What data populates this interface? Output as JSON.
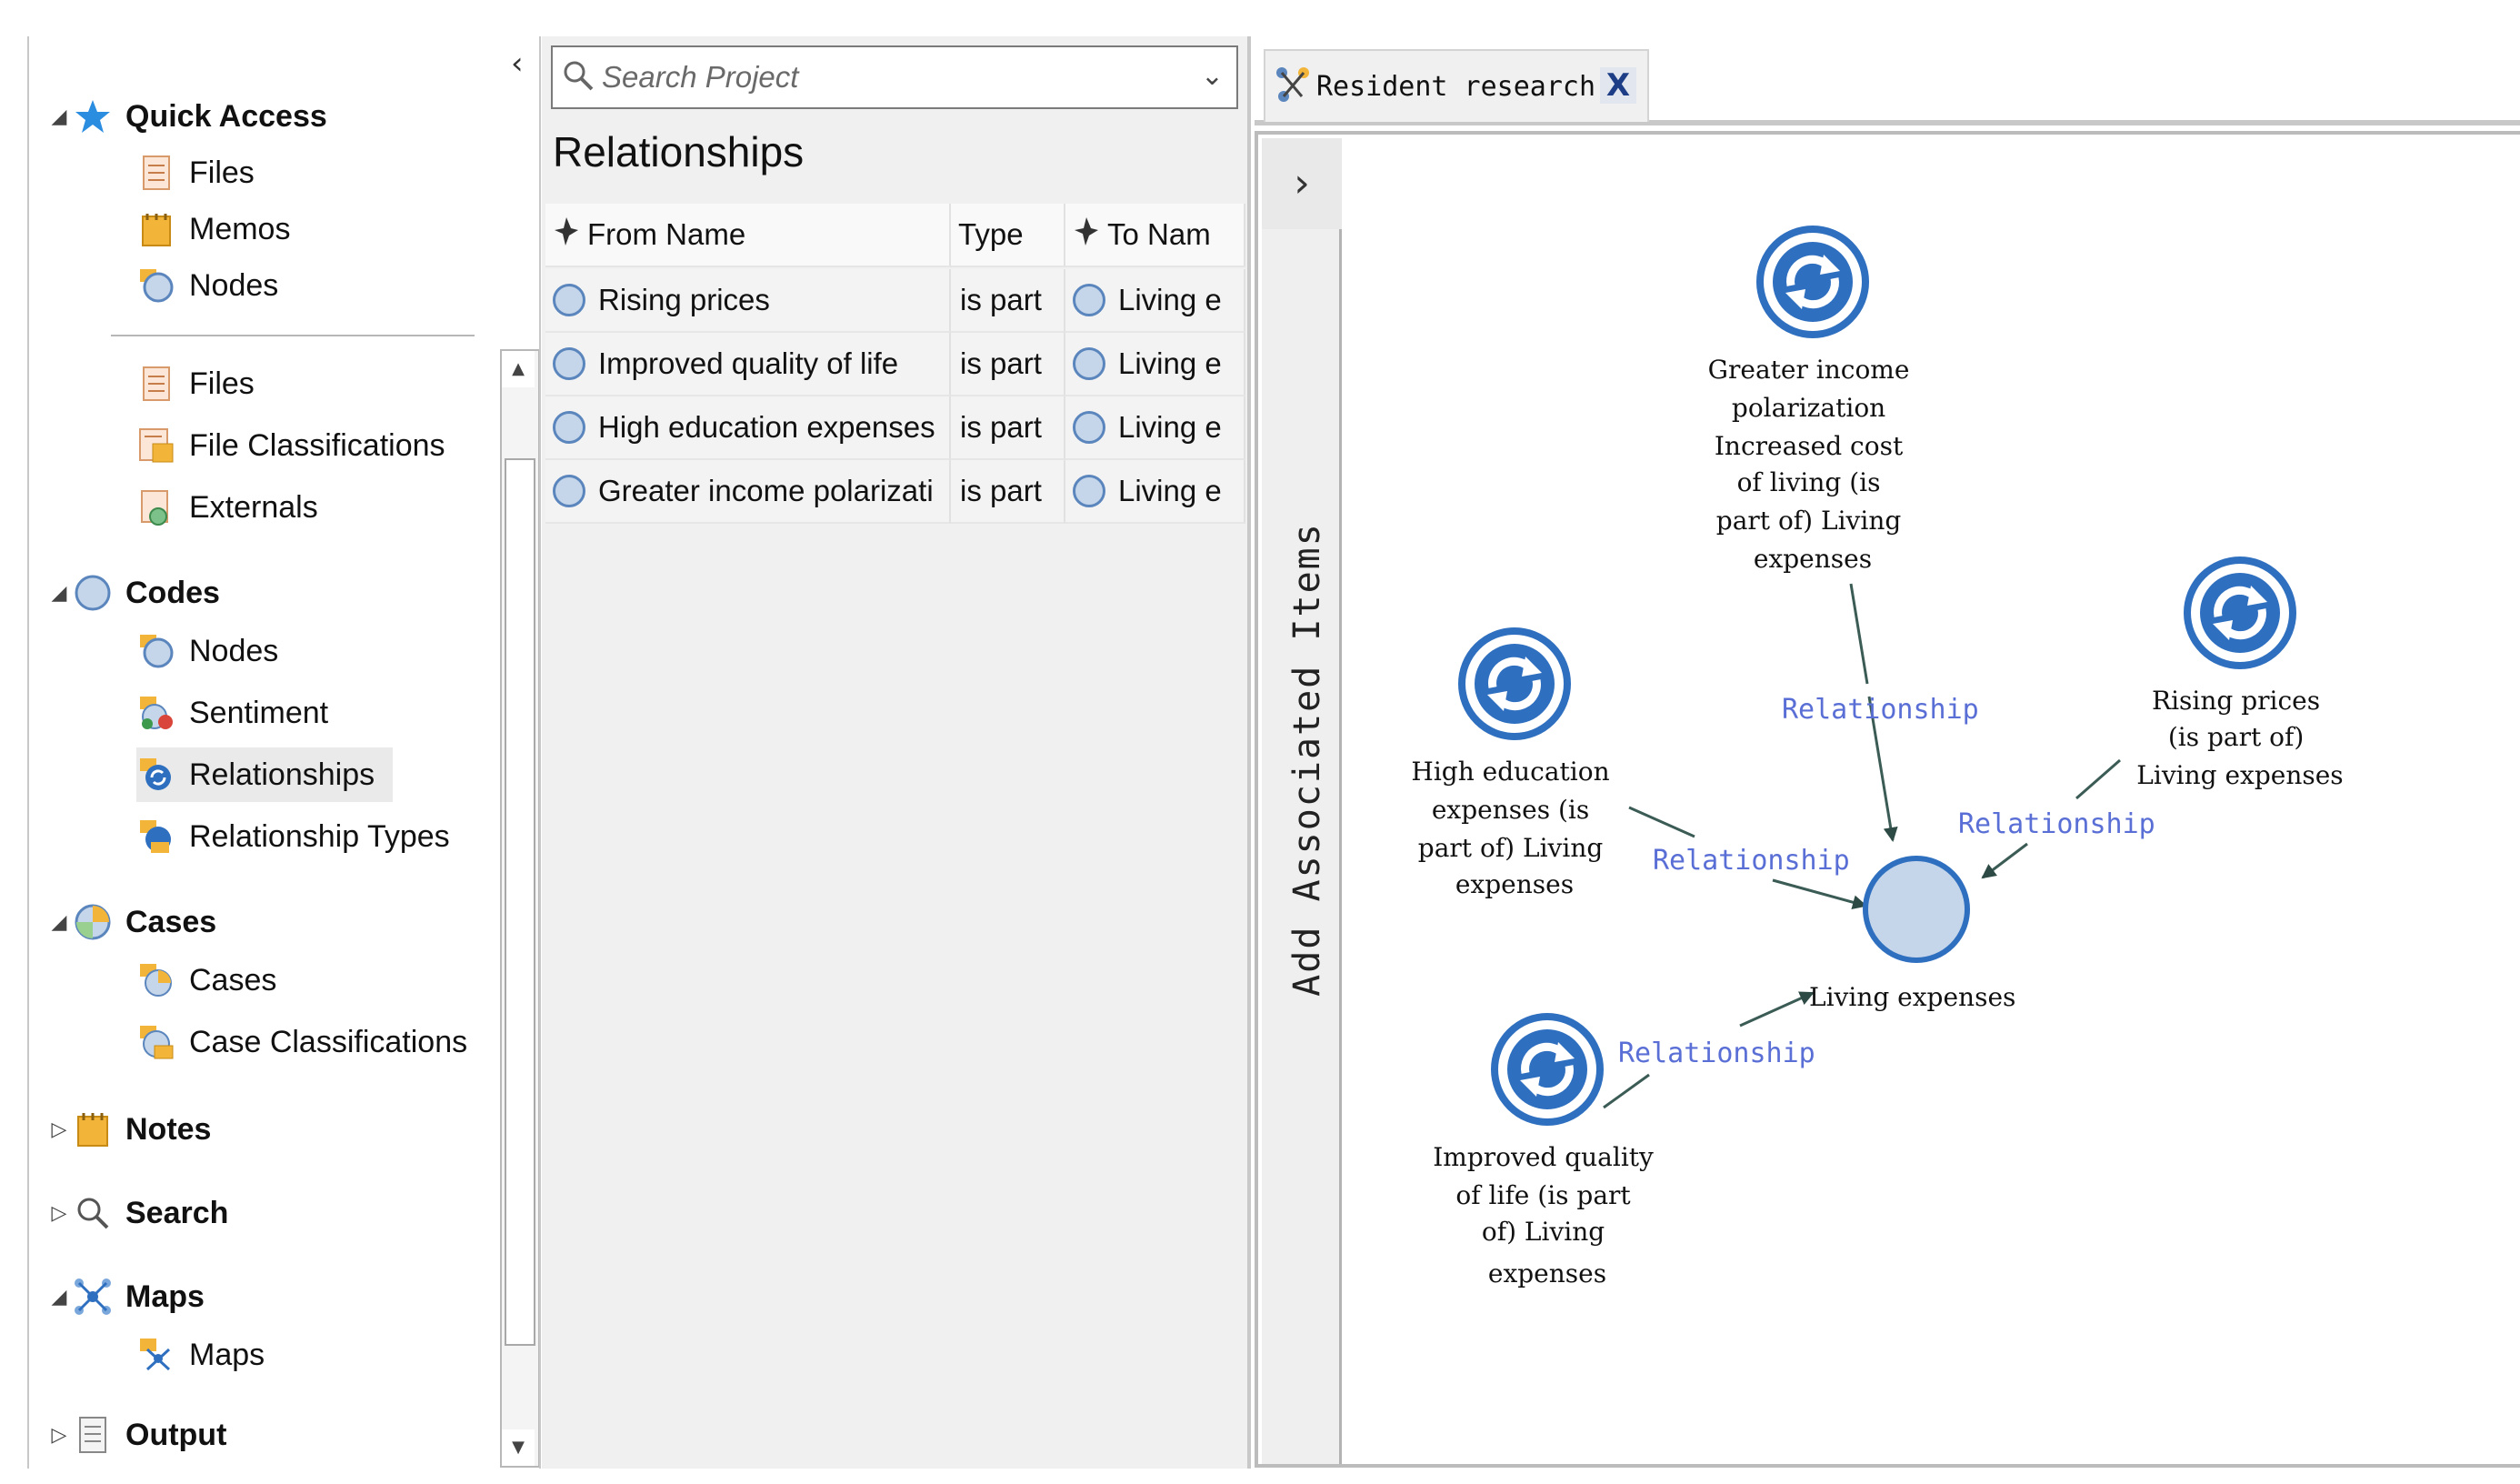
{
  "nav": {
    "collapse_glyph": "‹",
    "quick_access": {
      "label": "Quick Access",
      "items": [
        "Files",
        "Memos",
        "Nodes"
      ]
    },
    "data_items": [
      "Files",
      "File Classifications",
      "Externals"
    ],
    "codes": {
      "label": "Codes",
      "items": [
        "Nodes",
        "Sentiment",
        "Relationships",
        "Relationship Types"
      ]
    },
    "cases": {
      "label": "Cases",
      "items": [
        "Cases",
        "Case Classifications"
      ]
    },
    "notes": {
      "label": "Notes"
    },
    "search": {
      "label": "Search"
    },
    "maps": {
      "label": "Maps",
      "items": [
        "Maps"
      ]
    },
    "output": {
      "label": "Output"
    }
  },
  "list_view": {
    "search_placeholder": "Search Project",
    "title": "Relationships",
    "columns": [
      "From Name",
      "Type",
      "To Nam"
    ],
    "rows": [
      {
        "from": "Rising prices",
        "type": "is part",
        "to": "Living e"
      },
      {
        "from": "Improved quality of life",
        "type": "is part",
        "to": "Living e"
      },
      {
        "from": "High education expenses",
        "type": "is part",
        "to": "Living e"
      },
      {
        "from": "Greater income polarizati",
        "type": "is part",
        "to": "Living e"
      }
    ]
  },
  "map": {
    "tab_title": "Resident research",
    "close_glyph": "X",
    "expand_glyph": "›",
    "side_label": "Add Associated Items",
    "center_node": "Living expenses",
    "relationship_label": "Relationship",
    "relationship_nodes": [
      {
        "id": "greater",
        "lines": [
          "Greater income",
          "polarization",
          "Increased cost",
          "of living (is",
          "part of) Living",
          "expenses"
        ]
      },
      {
        "id": "rising",
        "lines": [
          "Rising prices",
          "(is part of)",
          "Living expenses"
        ]
      },
      {
        "id": "higher",
        "lines": [
          "High education",
          "expenses (is",
          "part of) Living",
          "expenses"
        ]
      },
      {
        "id": "improved",
        "lines": [
          "Improved quality",
          "of life (is part",
          "of) Living",
          "expenses"
        ]
      }
    ]
  },
  "colors": {
    "accent": "#2f6fbf",
    "link": "#5a6fd6",
    "node_fill": "#c5d6ea"
  }
}
